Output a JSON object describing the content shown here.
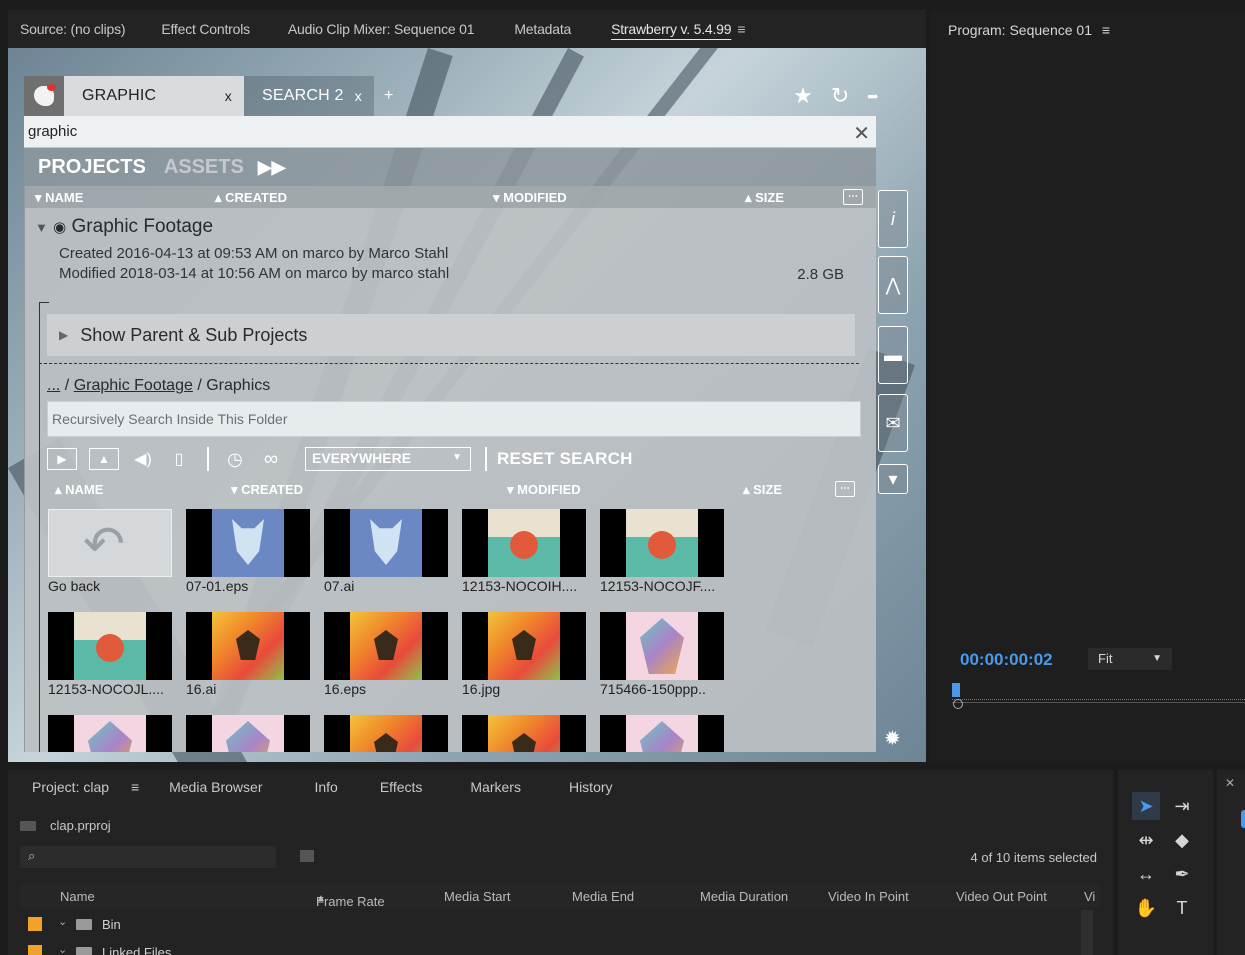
{
  "top_tabs": [
    {
      "label": "Source: (no clips)"
    },
    {
      "label": "Effect Controls"
    },
    {
      "label": "Audio Clip Mixer: Sequence 01"
    },
    {
      "label": "Metadata"
    },
    {
      "label": "Strawberry v. 5.4.99"
    }
  ],
  "menu_glyph": "≡",
  "plugin": {
    "tabs": [
      {
        "label": "GRAPHIC",
        "close": "x"
      },
      {
        "label": "SEARCH 2",
        "close": "x"
      }
    ],
    "add_tab": "+",
    "top_icons": {
      "star": "★",
      "refresh": "↻",
      "more": "•••"
    },
    "search_value": "graphic",
    "clear_glyph": "✕",
    "section_tabs": {
      "projects": "PROJECTS",
      "assets": "ASSETS",
      "arrow": "▶▶"
    },
    "columns": {
      "name": "NAME",
      "created": "CREATED",
      "modified": "MODIFIED",
      "size": "SIZE"
    },
    "project": {
      "title": "Graphic Footage",
      "created": "Created  2016-04-13 at 09:53 AM on marco by Marco Stahl",
      "modified": "Modified 2018-03-14 at 10:56 AM on marco by marco stahl",
      "size": "2.8 GB"
    },
    "sub_projects": "Show Parent & Sub Projects",
    "breadcrumb": {
      "ellipsis": "...",
      "sep1": " / ",
      "parent": "Graphic Footage",
      "sep2": " / ",
      "current": "Graphics"
    },
    "folder_search_placeholder": "Recursively Search Inside This Folder",
    "filter": {
      "scope": "EVERYWHERE",
      "reset": "RESET SEARCH"
    },
    "thumbnails": [
      {
        "label": "Go back",
        "kind": "goback"
      },
      {
        "label": "07-01.eps",
        "kind": "wolf"
      },
      {
        "label": "07.ai",
        "kind": "wolf"
      },
      {
        "label": "12153-NOCOIH....",
        "kind": "desk"
      },
      {
        "label": "12153-NOCOJF....",
        "kind": "desk"
      },
      {
        "label": "12153-NOCOJL....",
        "kind": "desk"
      },
      {
        "label": "16.ai",
        "kind": "be"
      },
      {
        "label": "16.eps",
        "kind": "be"
      },
      {
        "label": "16.jpg",
        "kind": "be"
      },
      {
        "label": "715466-150ppp..",
        "kind": "lion"
      }
    ]
  },
  "program": {
    "title": "Program: Sequence 01",
    "timecode": "00:00:00:02",
    "zoom": "Fit"
  },
  "project_panel": {
    "tabs": [
      {
        "label": "Project: clap"
      },
      {
        "label": "Media Browser"
      },
      {
        "label": "Info"
      },
      {
        "label": "Effects"
      },
      {
        "label": "Markers"
      },
      {
        "label": "History"
      }
    ],
    "file": "clap.prproj",
    "selection_status": "4 of 10 items selected",
    "columns": [
      "Name",
      "Frame Rate",
      "Media Start",
      "Media End",
      "Media Duration",
      "Video In Point",
      "Video Out Point",
      "Vi"
    ],
    "sort_glyph": "▲",
    "rows": [
      {
        "name": "Bin",
        "color": "#f2a12b"
      },
      {
        "name": "Linked Files",
        "color": "#f2a12b"
      }
    ]
  }
}
